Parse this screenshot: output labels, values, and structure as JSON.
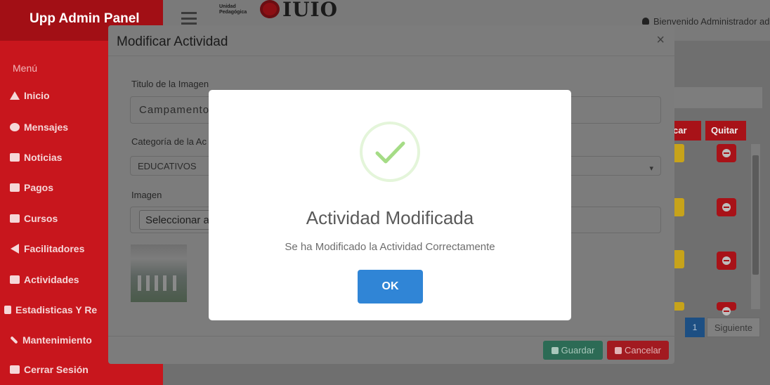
{
  "app": {
    "brand": "Upp Admin Panel",
    "logo_small_line1": "Unidad",
    "logo_small_line2": "Pedagógica",
    "logo_text": "IUIO",
    "welcome": "Bienvenido Administrador admi"
  },
  "sidebar": {
    "header": "Menú",
    "items": [
      {
        "label": "Inicio",
        "icon": "home-icon"
      },
      {
        "label": "Mensajes",
        "icon": "comment-icon"
      },
      {
        "label": "Noticias",
        "icon": "newspaper-icon"
      },
      {
        "label": "Pagos",
        "icon": "credit-card-icon"
      },
      {
        "label": "Cursos",
        "icon": "book-icon"
      },
      {
        "label": "Facilitadores",
        "icon": "megaphone-icon"
      },
      {
        "label": "Actividades",
        "icon": "image-icon"
      },
      {
        "label": "Estadisticas Y Re",
        "icon": "file-chart-icon"
      },
      {
        "label": "Mantenimiento",
        "icon": "tools-icon"
      },
      {
        "label": "Cerrar Sesión",
        "icon": "close-square-icon"
      }
    ]
  },
  "table": {
    "col_edit_partial": "car",
    "col_remove": "Quitar",
    "pagination_page": "1",
    "pagination_next": "Siguiente"
  },
  "modal": {
    "title": "Modificar Actividad",
    "close_glyph": "×",
    "title_label": "Titulo de la Imagen",
    "title_value": "Campamento",
    "category_label": "Categoría de la Ac",
    "category_value": "EDUCATIVOS",
    "image_label": "Imagen",
    "file_button": "Seleccionar a",
    "save_button": "Guardar",
    "cancel_button": "Cancelar"
  },
  "alert": {
    "title": "Actividad Modificada",
    "text": "Se ha Modificado la Actividad Correctamente",
    "ok_button": "OK",
    "icon": "success-check-icon"
  },
  "colors": {
    "sidebar": "#c8161d",
    "ok_button": "#3085d6",
    "success": "#a5dc86"
  }
}
